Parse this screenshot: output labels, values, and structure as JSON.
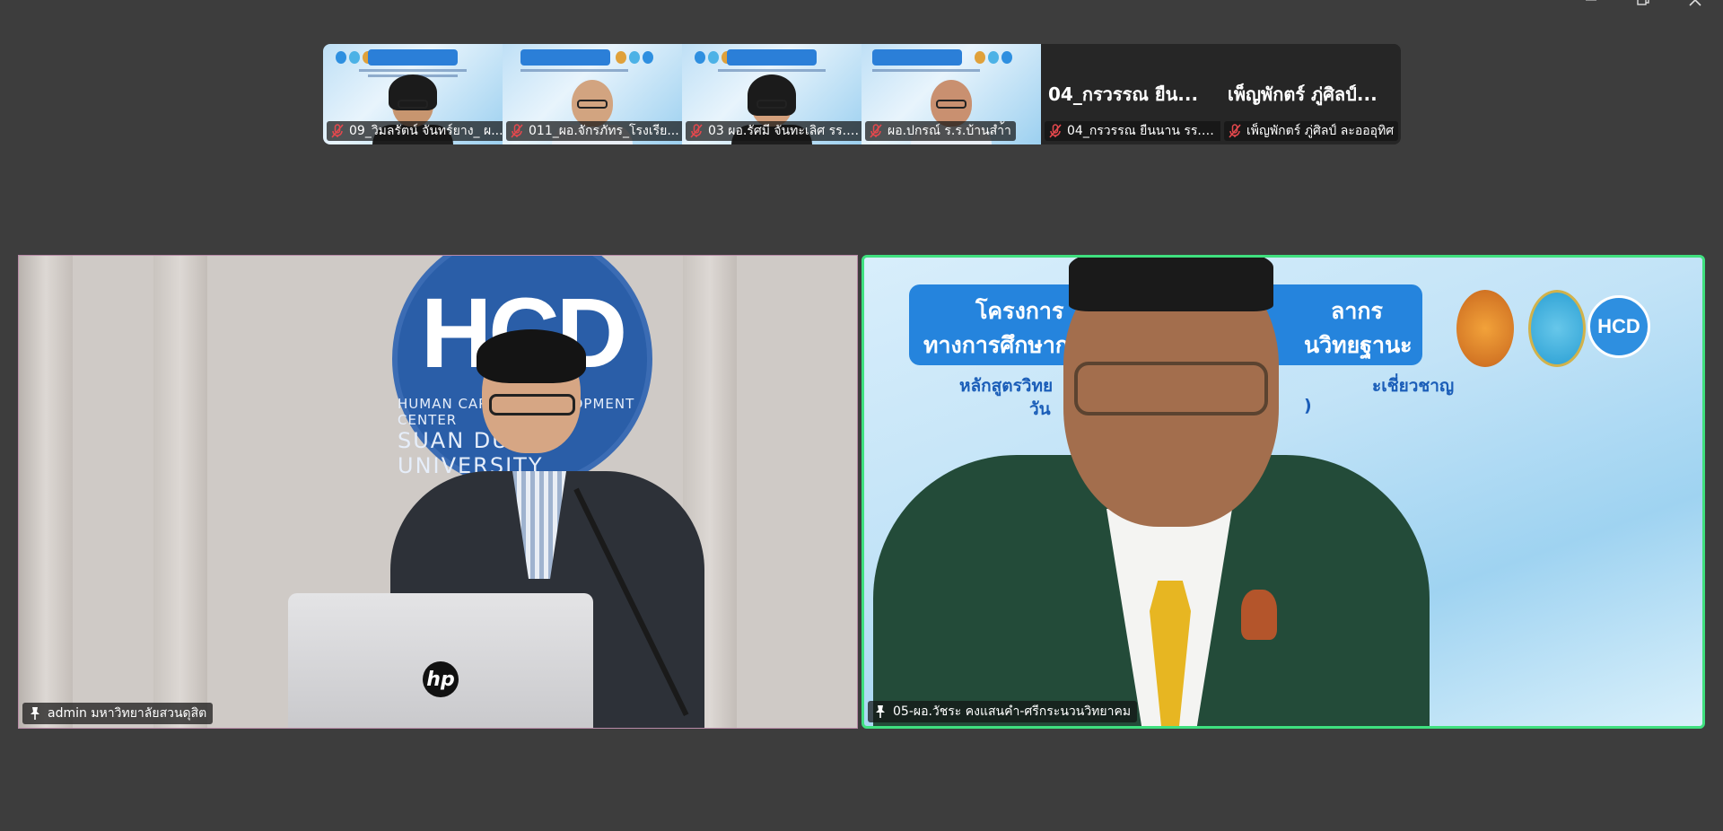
{
  "window": {
    "controls": [
      {
        "name": "minimize",
        "icon": "minimize-icon"
      },
      {
        "name": "restore",
        "icon": "restore-icon"
      },
      {
        "name": "close",
        "icon": "close-icon"
      }
    ]
  },
  "thumbnails": [
    {
      "type": "video",
      "label": "09_วิมลรัตน์ จันทร์ยาง_ ผ...",
      "muted": true,
      "shirt": "#1d1d1d",
      "hair": true
    },
    {
      "type": "video",
      "label": "011_ผอ.จักรภัทร_โรงเรีย...",
      "muted": true,
      "shirt": "#e9eef5",
      "hair": false
    },
    {
      "type": "video",
      "label": "03 ผอ.รัศมี จันทะเลิศ รร.ว...",
      "muted": true,
      "shirt": "#1d1d1d",
      "hair": true
    },
    {
      "type": "video",
      "label": "ผอ.ปกรณ์ ร.ร.บ้านสำ้า",
      "muted": true,
      "shirt": "#e9eef5",
      "hair": false
    },
    {
      "type": "name",
      "big_name": "04_กรวรรณ ยืน...",
      "label": "04_กรวรรณ ยืนนาน รร.บ...",
      "muted": true
    },
    {
      "type": "name",
      "big_name": "เพ็ญพักตร์ ภู่ศิลป์...",
      "label": "เพ็ญพักตร์ ภู่ศิลป์ ละอออุทิศ",
      "muted": true
    }
  ],
  "main_tiles": {
    "left": {
      "name": "admin มหาวิทยาลัยสวนดุสิต",
      "pinned": true,
      "logo": {
        "big": "HCD",
        "line1": "HUMAN CAPITAL DEVELOPMENT CENTER",
        "line2": "SUAN DUSIT UNIVERSITY"
      },
      "laptop_brand": "hp"
    },
    "right": {
      "name": "05-ผอ.วัชระ คงแสนคำ-ศรีกระนวนวิทยาคม",
      "pinned": true,
      "active_speaker": true,
      "banner_line1": "โครงการ",
      "banner_line1_end": "ลากร",
      "banner_line2": "ทางการศึกษาก",
      "banner_line2_end": "นวิทยฐานะ",
      "sub_line1": "หลักสูตรวิทย",
      "sub_line1_end": "ะเชี่ยวชาญ",
      "sub_line2": "วัน",
      "sub_line2_end": ")",
      "logo_text": "HCD"
    }
  },
  "colors": {
    "background": "#3d3d3d",
    "active_border": "#3fe07f",
    "mic_off": "#e5484d"
  }
}
